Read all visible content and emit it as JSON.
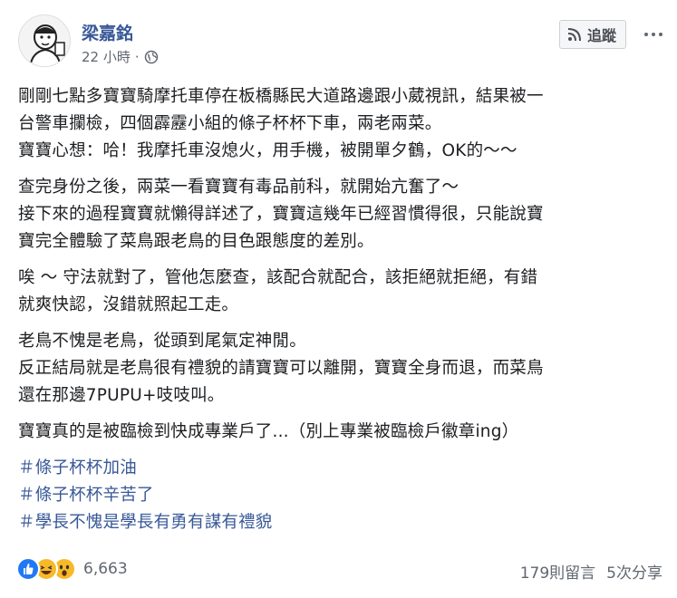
{
  "header": {
    "author": "梁嘉銘",
    "time": "22 小時",
    "separator": "·",
    "follow_label": "追蹤"
  },
  "post": {
    "paragraphs": [
      [
        "剛剛七點多寶寶騎摩托車停在板橋縣民大道路邊跟小葳視訊，結果被一",
        "台警車攔檢，四個霹靂小組的條子杯杯下車，兩老兩菜。",
        "寶寶心想：哈！我摩托車沒熄火，用手機，被開單夕鶴，OK的～～"
      ],
      [
        "查完身份之後，兩菜一看寶寶有毒品前科，就開始亢奮了～",
        "接下來的過程寶寶就懶得詳述了，寶寶這幾年已經習慣得很，只能說寶",
        "寶完全體驗了菜鳥跟老鳥的目色跟態度的差別。"
      ],
      [
        "唉 ～ 守法就對了，管他怎麼查，該配合就配合，該拒絕就拒絕，有錯",
        "就爽快認，沒錯就照起工走。"
      ],
      [
        "老鳥不愧是老鳥，從頭到尾氣定神閒。",
        "反正結局就是老鳥很有禮貌的請寶寶可以離開，寶寶全身而退，而菜鳥",
        "還在那邊7PUPU+吱吱叫。"
      ],
      [
        "寶寶真的是被臨檢到快成專業戶了...（別上專業被臨檢戶徽章ing）"
      ]
    ],
    "hashtags": [
      "＃條子杯杯加油",
      "＃條子杯杯辛苦了",
      "＃學長不愧是學長有勇有謀有禮貌"
    ]
  },
  "footer": {
    "reaction_count": "6,663",
    "comments": "179則留言",
    "shares": "5次分享"
  },
  "colors": {
    "link": "#385898",
    "secondary_text": "#606770",
    "like_blue": "#2078f4",
    "emoji_yellow": "#f7b928"
  },
  "icons": [
    "avatar",
    "globe-icon",
    "rss-icon",
    "more-icon",
    "like-reaction-icon",
    "haha-reaction-icon",
    "wow-reaction-icon"
  ]
}
